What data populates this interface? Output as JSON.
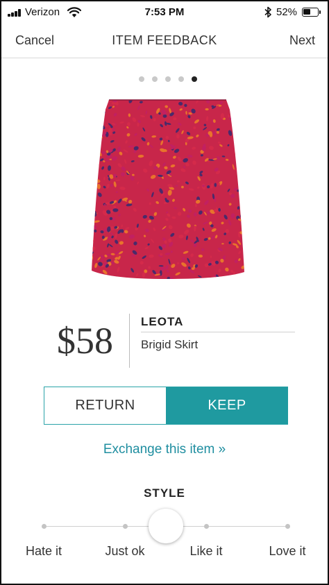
{
  "status_bar": {
    "carrier": "Verizon",
    "time": "7:53 PM",
    "battery_pct": "52%",
    "battery_level": 0.52,
    "icons": [
      "signal-bars-icon",
      "wifi-icon",
      "bluetooth-icon",
      "battery-icon"
    ]
  },
  "nav": {
    "cancel_label": "Cancel",
    "title": "ITEM FEEDBACK",
    "next_label": "Next"
  },
  "carousel": {
    "page_count": 5,
    "active_page": 5
  },
  "product": {
    "price": "$58",
    "brand": "LEOTA",
    "name": "Brigid Skirt",
    "image_colors": [
      "#d42a4a",
      "#e8732c",
      "#4a2a6a",
      "#c22060"
    ]
  },
  "decision": {
    "return_label": "RETURN",
    "keep_label": "KEEP",
    "selected": "KEEP",
    "accent_color": "#1f9aa0"
  },
  "exchange_link": "Exchange this item »",
  "style_rating": {
    "title": "STYLE",
    "labels": [
      "Hate it",
      "Just ok",
      "Like it",
      "Love it"
    ],
    "value_fraction": 0.5
  }
}
